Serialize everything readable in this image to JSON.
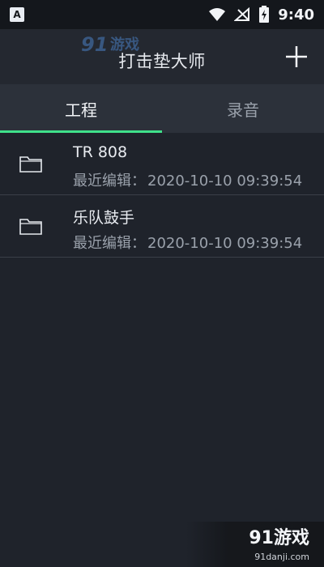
{
  "status_bar": {
    "notification_icon_label": "A",
    "time": "9:40"
  },
  "app_bar": {
    "title": "打击垫大师",
    "watermark_text": "91游戏"
  },
  "tabs": [
    {
      "label": "工程",
      "active": true
    },
    {
      "label": "录音",
      "active": false
    }
  ],
  "projects": [
    {
      "title": "TR 808",
      "modified_label": "最近编辑：",
      "modified_time": "2020-10-10 09:39:54"
    },
    {
      "title": "乐队鼓手",
      "modified_label": "最近编辑：",
      "modified_time": "2020-10-10 09:39:54"
    }
  ],
  "watermark_bottom": {
    "brand": "91游戏",
    "url": "91danji.com"
  },
  "colors": {
    "background": "#1f232b",
    "accent": "#3fe08a"
  },
  "icons": {
    "add": "plus-icon",
    "folder": "folder-icon",
    "wifi": "wifi-icon",
    "signal": "signal-off-icon",
    "battery": "battery-charging-icon"
  }
}
